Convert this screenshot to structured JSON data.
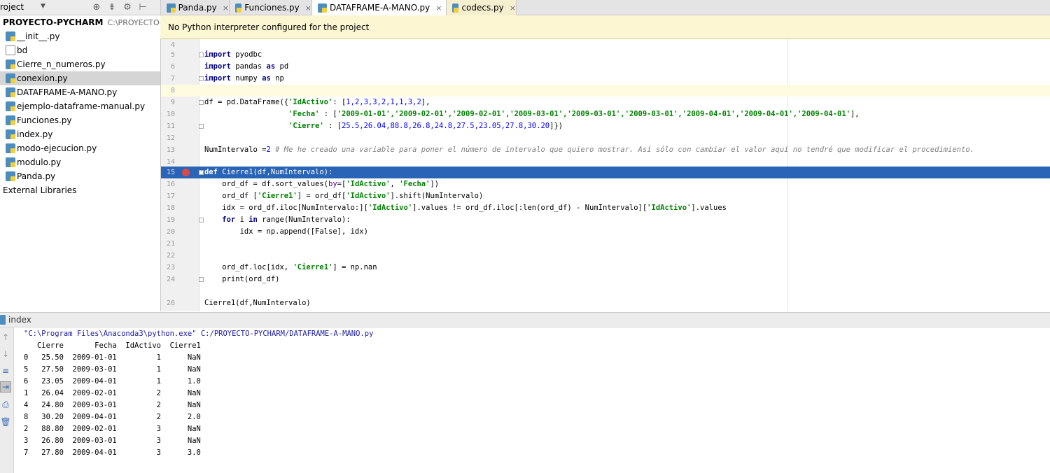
{
  "project_panel": {
    "header_label": "roject",
    "root_name": "PROYECTO-PYCHARM",
    "root_path": "C:\\PROYECTO-PYCHARM",
    "items": [
      {
        "label": "__init__.py",
        "icon": "python-file-icon"
      },
      {
        "label": "bd",
        "icon": "file-icon"
      },
      {
        "label": "Cierre_n_numeros.py",
        "icon": "python-file-icon"
      },
      {
        "label": "conexion.py",
        "icon": "python-file-icon",
        "selected": true
      },
      {
        "label": "DATAFRAME-A-MANO.py",
        "icon": "python-file-icon"
      },
      {
        "label": "ejemplo-dataframe-manual.py",
        "icon": "python-file-icon"
      },
      {
        "label": "Funciones.py",
        "icon": "python-file-icon"
      },
      {
        "label": "index.py",
        "icon": "python-file-icon"
      },
      {
        "label": "modo-ejecucion.py",
        "icon": "python-file-icon"
      },
      {
        "label": "modulo.py",
        "icon": "python-file-icon"
      },
      {
        "label": "Panda.py",
        "icon": "python-file-icon"
      }
    ],
    "external_libraries": "External Libraries"
  },
  "tabs": [
    {
      "label": "Panda.py",
      "close": "×"
    },
    {
      "label": "Funciones.py",
      "close": "×"
    },
    {
      "label": "DATAFRAME-A-MANO.py",
      "close": "×",
      "active": true
    },
    {
      "label": "codecs.py",
      "close": "×"
    }
  ],
  "banner": "No Python interpreter configured for the project",
  "editor": {
    "lines": {
      "l4": "4",
      "l5": "5",
      "l6": "6",
      "l7": "7",
      "l8": "8",
      "l9": "9",
      "l10": "10",
      "l11": "11",
      "l12": "12",
      "l13": "13",
      "l14": "14",
      "l15": "15",
      "l16": "16",
      "l17": "17",
      "l18": "18",
      "l19": "19",
      "l20": "20",
      "l21": "21",
      "l22": "22",
      "l23": "23",
      "l24": "24",
      "l26": "26"
    },
    "code": {
      "c5_kw": "import",
      "c5_rest": " pyodbc",
      "c6_kw": "import",
      "c6_mid": " pandas ",
      "c6_kw2": "as",
      "c6_rest": " pd",
      "c7_kw": "import",
      "c7_mid": " numpy ",
      "c7_kw2": "as",
      "c7_rest": " np",
      "c9_a": "df = pd.DataFrame({",
      "c9_s1": "'IdActivo'",
      "c9_b": ": [",
      "c9_nums": "1,2,3,3,2,1,1,3,2",
      "c9_c": "],",
      "c10_indent": "                   ",
      "c10_s1": "'Fecha'",
      "c10_b": " : [",
      "c10_dates": "'2009-01-01','2009-02-01','2009-02-01','2009-03-01','2009-03-01','2009-03-01','2009-04-01','2009-04-01','2009-04-01'",
      "c10_c": "],",
      "c11_indent": "                   ",
      "c11_s1": "'Cierre'",
      "c11_b": " : [",
      "c11_nums": "25.5,26.04,88.8,26.8,24.8,27.5,23.05,27.8,30.20",
      "c11_c": "]})",
      "c13_a": "NumIntervalo =",
      "c13_num": "2",
      "c13_cmt": " # Me he creado una variable para poner el número de intervalo que quiero mostrar. Así sólo con cambiar el valor aquí no tendré que modificar el procedimiento.",
      "c15_kw": "def",
      "c15_rest": " Cierre1(df,NumIntervalo):",
      "c16_a": "    ord_df = df.sort_values(",
      "c16_kw": "by",
      "c16_b": "=[",
      "c16_s1": "'IdActivo'",
      "c16_c": ", ",
      "c16_s2": "'Fecha'",
      "c16_d": "])",
      "c17_a": "    ord_df [",
      "c17_s1": "'Cierre1'",
      "c17_b": "] = ord_df[",
      "c17_s2": "'IdActivo'",
      "c17_c": "].shift(NumIntervalo)",
      "c18_a": "    idx = ord_df.iloc[NumIntervalo:][",
      "c18_s1": "'IdActivo'",
      "c18_b": "].values != ord_df.iloc[:len(ord_df) - NumIntervalo][",
      "c18_s2": "'IdActivo'",
      "c18_c": "].values",
      "c19_a": "    ",
      "c19_kw": "for",
      "c19_b": " i ",
      "c19_kw2": "in",
      "c19_c": " range(NumIntervalo):",
      "c20_a": "        idx = np.append([False], idx)",
      "c23_a": "    ord_df.loc[idx, ",
      "c23_s1": "'Cierre1'",
      "c23_b": "] = np.nan",
      "c24_a": "    print(ord_df)",
      "c26_a": "Cierre1(df,NumIntervalo)"
    }
  },
  "run_panel": {
    "title": "index",
    "console_lines": [
      "\"C:\\Program Files\\Anaconda3\\python.exe\" C:/PROYECTO-PYCHARM/DATAFRAME-A-MANO.py",
      "   Cierre       Fecha  IdActivo  Cierre1",
      "0   25.50  2009-01-01         1      NaN",
      "5   27.50  2009-03-01         1      NaN",
      "6   23.05  2009-04-01         1      1.0",
      "1   26.04  2009-02-01         2      NaN",
      "4   24.80  2009-03-01         2      NaN",
      "8   30.20  2009-04-01         2      2.0",
      "2   88.80  2009-02-01         3      NaN",
      "3   26.80  2009-03-01         3      NaN",
      "7   27.80  2009-04-01         3      3.0"
    ]
  },
  "colors": {
    "selection_line": "#2a64b7",
    "banner_bg": "#fcf7d2",
    "keyword": "#000080",
    "string": "#008000",
    "number": "#0000ff",
    "comment": "#808080"
  }
}
